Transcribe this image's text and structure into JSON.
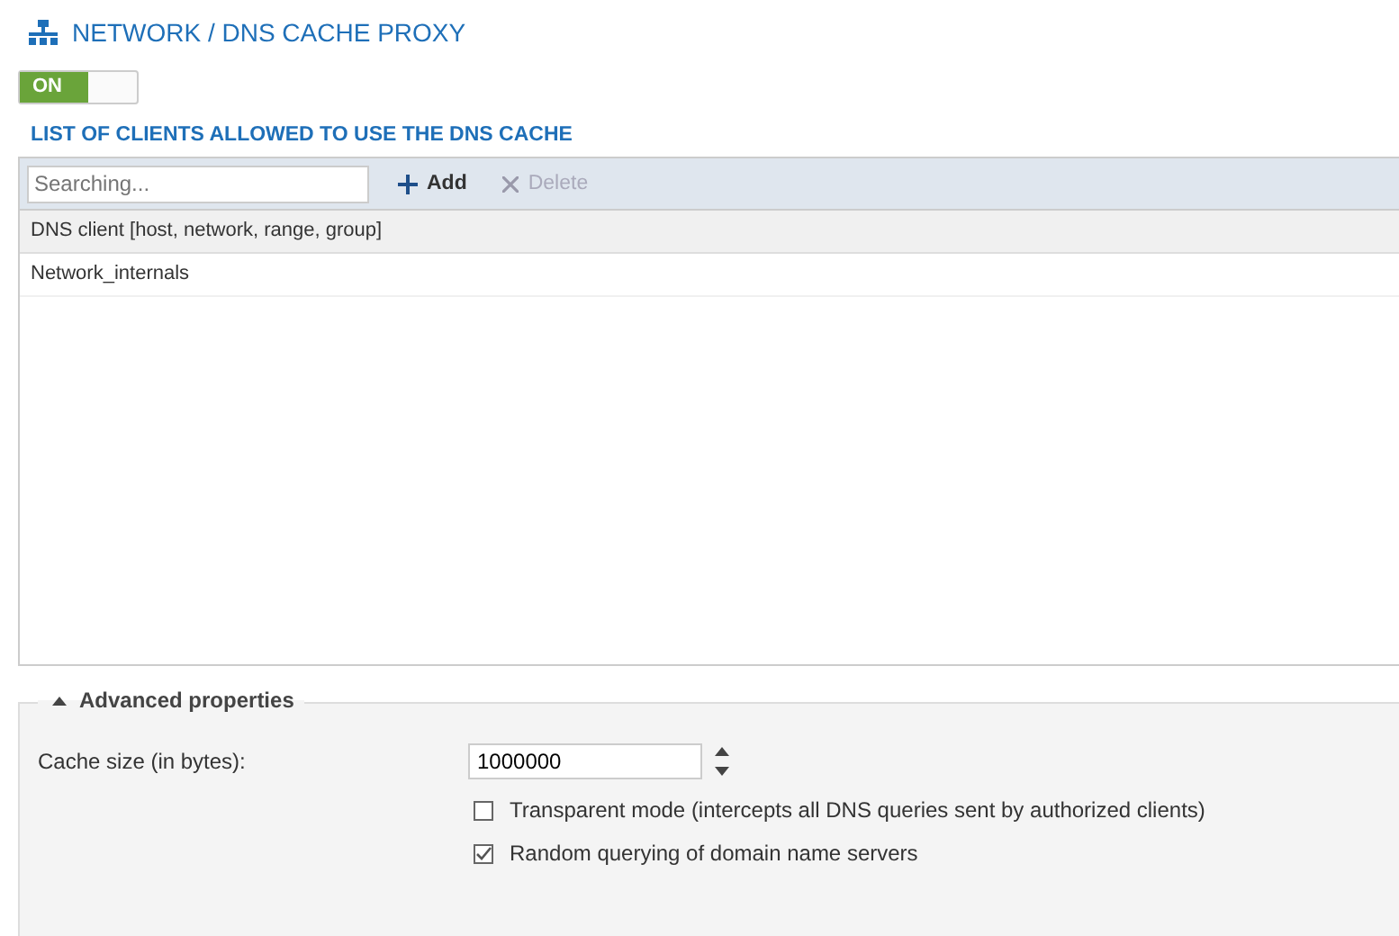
{
  "page_title": "NETWORK / DNS CACHE PROXY",
  "toggle": {
    "label": "ON",
    "on": true
  },
  "section_title": "LIST OF CLIENTS ALLOWED TO USE THE DNS CACHE",
  "toolbar": {
    "search_placeholder": "Searching...",
    "buttons": [
      {
        "kind": "add",
        "label": "Add",
        "disabled": false
      },
      {
        "kind": "delete",
        "label": "Delete",
        "disabled": true
      }
    ]
  },
  "table": {
    "columns": [
      "DNS client [host, network, range, group]"
    ],
    "rows": [
      "Network_internals"
    ]
  },
  "advanced": {
    "title": "Advanced properties",
    "expanded": true,
    "cache_label": "Cache size (in bytes):",
    "cache_value": "1000000",
    "options": [
      {
        "label": "Transparent mode (intercepts all DNS queries sent by authorized clients)",
        "checked": false
      },
      {
        "label": "Random querying of domain name servers",
        "checked": true
      }
    ]
  }
}
